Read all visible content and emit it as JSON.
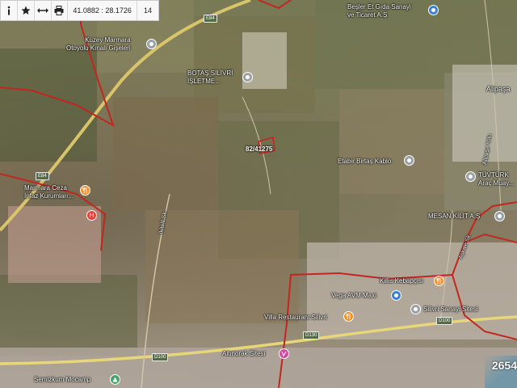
{
  "toolbar": {
    "info_icon": "info-icon",
    "favorite_icon": "star-icon",
    "measure_icon": "arrows-icon",
    "print_icon": "print-icon",
    "coordinates": "41.0882 : 28.1726",
    "zoom": "14"
  },
  "roads": {
    "e84_top": "E84",
    "e84_left": "E84",
    "d100_left": "D100",
    "d100_mid": "D100",
    "d130": "D130",
    "ikitelli": "İkitelli Sk.",
    "askale": "Aşkale Sk.",
    "alipasa_yolu": "Alipaşa Yolu"
  },
  "places": [
    {
      "id": "kuzey-marmara",
      "label_lines": [
        "Kuzey Marmara",
        "Otoyolu Kınalı Gişeleri"
      ],
      "pin": "grey"
    },
    {
      "id": "botas",
      "label_lines": [
        "BOTAŞ SİLİVRİ",
        "İŞLETME..."
      ],
      "pin": "grey"
    },
    {
      "id": "besler",
      "label_lines": [
        "Beşler Et Gıda Sanayi",
        "ve Ticaret A.Ş"
      ],
      "pin": "blue"
    },
    {
      "id": "alipasa",
      "label_lines": [
        "Alipaşa"
      ],
      "pin": ""
    },
    {
      "id": "etabir",
      "label_lines": [
        "Etabir Birtaş Kablo"
      ],
      "pin": "grey"
    },
    {
      "id": "tuvturk",
      "label_lines": [
        "TÜVTÜRK",
        "Araç Muay..."
      ],
      "pin": "grey"
    },
    {
      "id": "mesan",
      "label_lines": [
        "MESAN KİLİT A.Ş"
      ],
      "pin": "grey"
    },
    {
      "id": "marmara-ceza",
      "label_lines": [
        "Marmara Ceza",
        "İnfaz Kurumları..."
      ],
      "pin": "orange"
    },
    {
      "id": "killis",
      "label_lines": [
        "Killis Kebapçısı"
      ],
      "pin": "orange"
    },
    {
      "id": "vega",
      "label_lines": [
        "Vega AVM Maxi"
      ],
      "pin": "blue"
    },
    {
      "id": "silivri-sanayi",
      "label_lines": [
        "Silivri Sanayi Sitesi"
      ],
      "pin": "grey"
    },
    {
      "id": "villa",
      "label_lines": [
        "Villa Restaurant Silivri"
      ],
      "pin": "orange"
    },
    {
      "id": "altinorak",
      "label_lines": [
        "Altınorak Sitesi"
      ],
      "pin": "pink"
    },
    {
      "id": "semizkum",
      "label_lines": [
        "Semizkum Mocamp"
      ],
      "pin": "green"
    }
  ],
  "parcel": {
    "label": "82/41275",
    "outline_color": "#cc1f1f"
  },
  "boundary_color": "#c2261f",
  "corner_number": "2654"
}
